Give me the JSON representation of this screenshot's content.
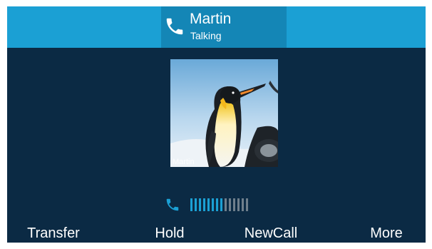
{
  "header": {
    "caller_name": "Martin",
    "call_status": "Talking",
    "phone_icon": "handset-icon"
  },
  "avatar": {
    "overlay_text": "Martin",
    "picture": "penguin-photo"
  },
  "volume": {
    "icon": "handset-icon",
    "level": 8,
    "max": 14,
    "active_color": "#1ba0d4",
    "inactive_color": "#6f7f8c"
  },
  "softkeys": [
    {
      "label": "Transfer"
    },
    {
      "label": "Hold"
    },
    {
      "label": "NewCall"
    },
    {
      "label": "More"
    }
  ],
  "colors": {
    "background": "#0b2a44",
    "header": "#1ba0d4",
    "caller_tab": "#1486b6"
  }
}
